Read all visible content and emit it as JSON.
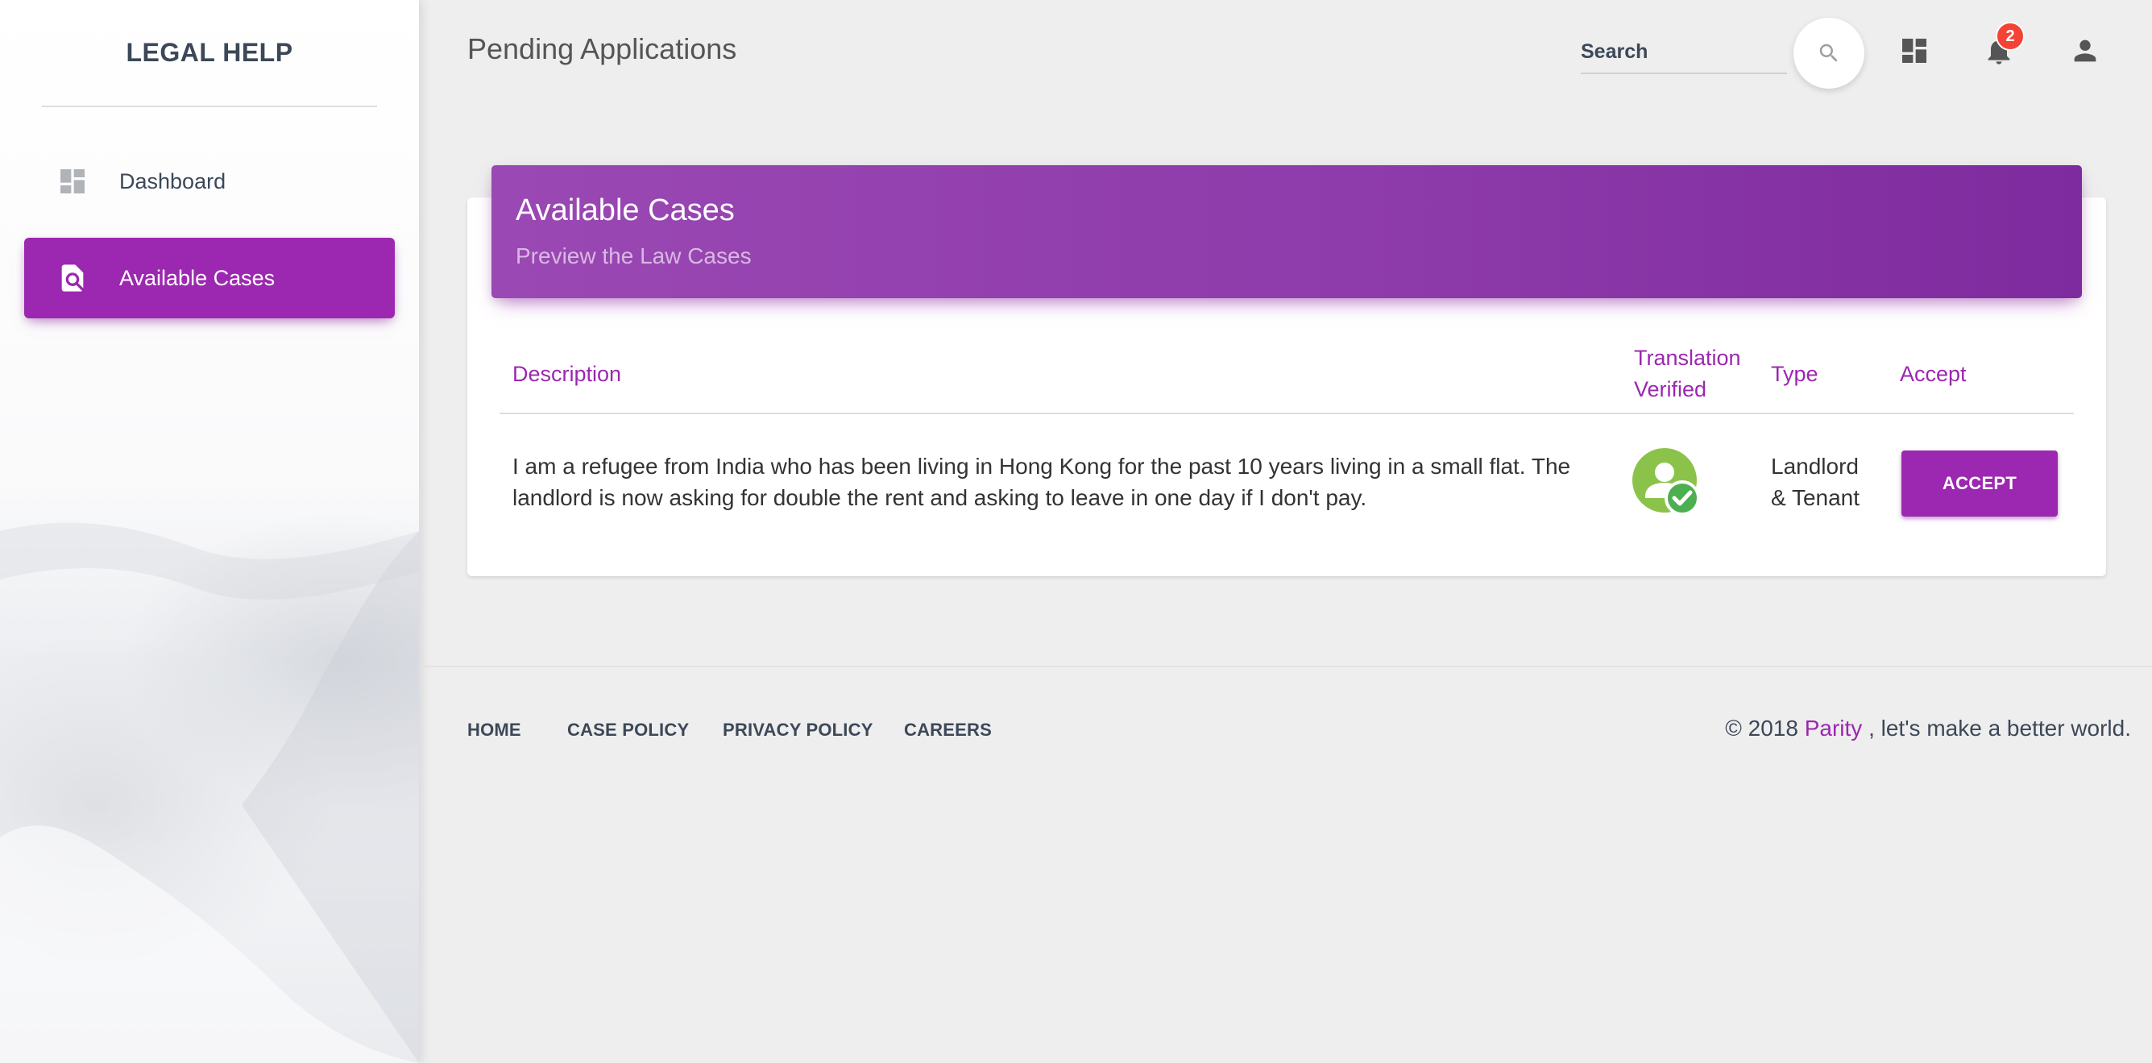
{
  "sidebar": {
    "brand": "LEGAL HELP",
    "items": [
      {
        "label": "Dashboard",
        "icon": "dashboard-icon",
        "active": false
      },
      {
        "label": "Available Cases",
        "icon": "find-in-page-icon",
        "active": true
      }
    ]
  },
  "header": {
    "title": "Pending Applications",
    "search_placeholder": "Search",
    "notifications_count": "2"
  },
  "card": {
    "title": "Available Cases",
    "subtitle": "Preview the Law Cases",
    "columns": {
      "description": "Description",
      "translation_line1": "Translation",
      "translation_line2": "Verified",
      "type": "Type",
      "accept": "Accept"
    },
    "rows": [
      {
        "description_line1": "I am a refugee from India who has been living in Hong Kong for the past 10 years living in a small flat. The",
        "description_line2": "landlord is now asking for double the rent and asking to leave in one day if I don't pay.",
        "translation_verified": true,
        "type_line1": "Landlord",
        "type_line2": "& Tenant",
        "accept_label": "ACCEPT"
      }
    ]
  },
  "footer": {
    "links": [
      "HOME",
      "CASE POLICY",
      "PRIVACY POLICY",
      "CAREERS"
    ],
    "copyright_prefix": "© 2018",
    "copyright_brand": "Parity",
    "copyright_suffix": ", let's make a better world."
  },
  "colors": {
    "accent": "#9c27b0",
    "verified_green": "#8bc34a",
    "badge_red": "#f44336",
    "text": "#3c4858"
  }
}
